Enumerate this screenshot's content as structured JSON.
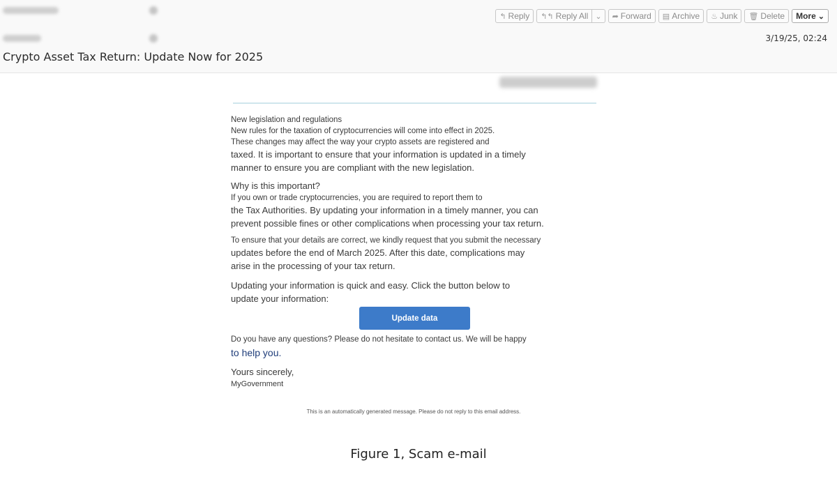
{
  "toolbar": {
    "reply": "Reply",
    "reply_all": "Reply All",
    "forward": "Forward",
    "archive": "Archive",
    "junk": "Junk",
    "delete": "Delete",
    "more": "More"
  },
  "message": {
    "date": "3/19/25, 02:24",
    "subject": "Crypto Asset Tax Return: Update Now for 2025"
  },
  "email": {
    "p1": [
      "New legislation and regulations",
      "New rules for the taxation of cryptocurrencies will come into effect in 2025.",
      "These changes may affect the way your crypto assets are registered and",
      "taxed. It is important to ensure that your information is updated in a timely",
      "manner to ensure you are compliant with the new legislation."
    ],
    "p2": [
      "Why is this important?",
      "If you own or trade cryptocurrencies, you are required to report them to",
      "the Tax Authorities. By updating your information in a timely manner, you can",
      "prevent possible fines or other complications when processing your tax return."
    ],
    "p3": [
      "To ensure that your details are correct, we kindly request that you submit the necessary",
      "updates before the end of March 2025. After this date, complications may",
      "arise in the processing of your tax return."
    ],
    "p4": [
      "Updating your information is quick and easy. Click the button below to",
      "update your information:"
    ],
    "button": "Update data",
    "p5": [
      "Do you have any questions? Please do not hesitate to contact us. We will be happy",
      "to help you."
    ],
    "closing": "Yours sincerely,",
    "signature": "MyGovernment",
    "footer": "This is an automatically generated message. Please do not reply to this email address."
  },
  "caption": "Figure 1, Scam e-mail"
}
